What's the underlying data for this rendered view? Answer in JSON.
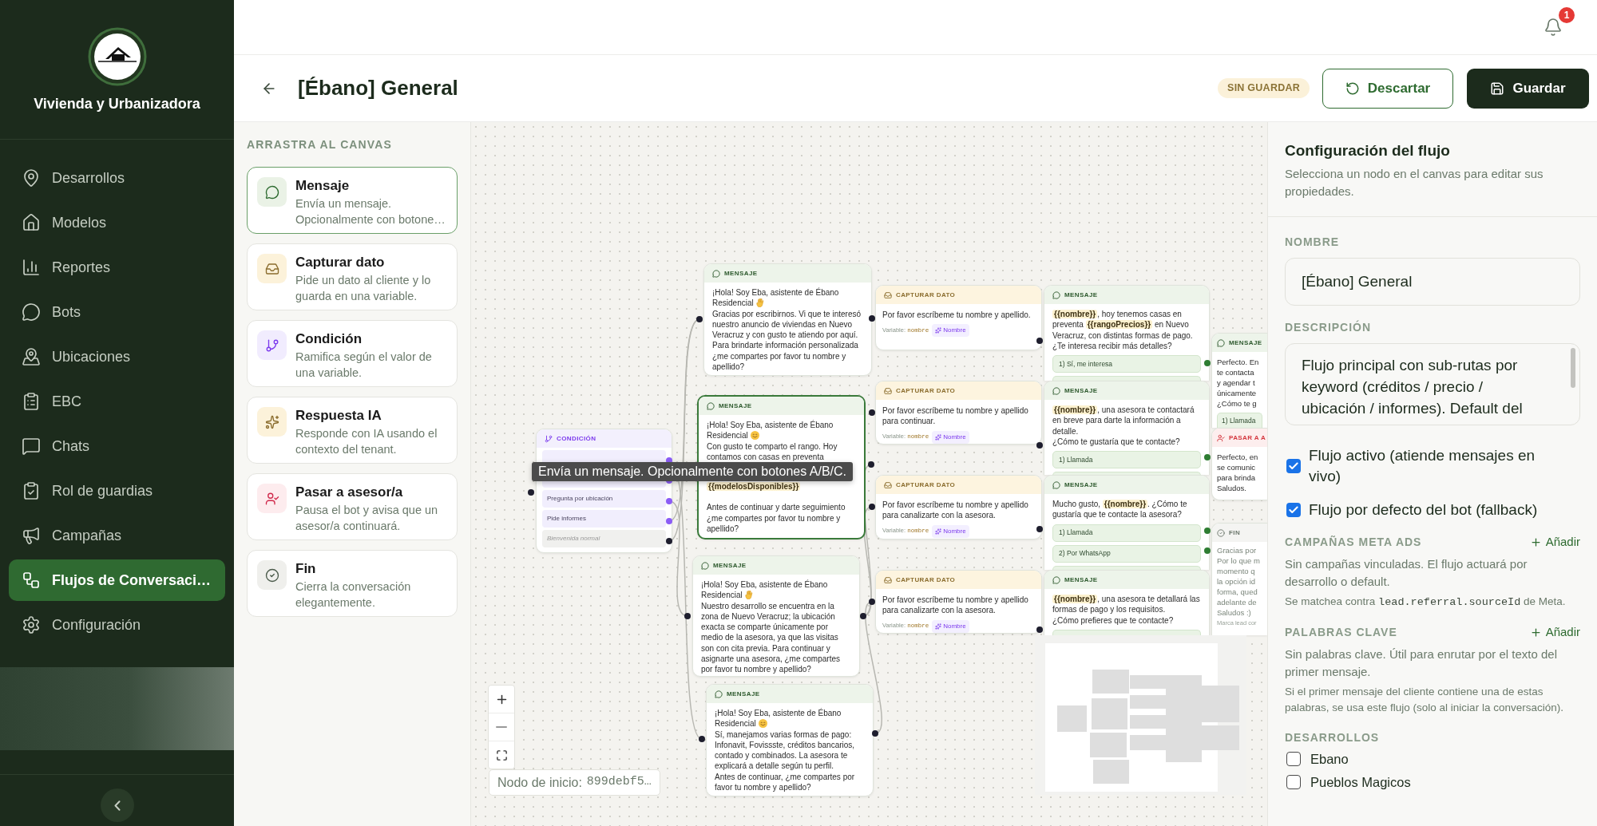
{
  "sidebar": {
    "brand": "Vivienda y Urbanizadora",
    "nav": [
      {
        "label": "Desarrollos",
        "selected": false
      },
      {
        "label": "Modelos",
        "selected": false
      },
      {
        "label": "Reportes",
        "selected": false
      },
      {
        "label": "Bots",
        "selected": false
      },
      {
        "label": "Ubicaciones",
        "selected": false
      },
      {
        "label": "EBC",
        "selected": false
      },
      {
        "label": "Chats",
        "selected": false
      },
      {
        "label": "Rol de guardias",
        "selected": false
      },
      {
        "label": "Campañas",
        "selected": false
      },
      {
        "label": "Flujos de Conversaci…",
        "selected": true
      },
      {
        "label": "Configuración",
        "selected": false
      }
    ]
  },
  "topbar": {
    "notification_count": "1"
  },
  "header": {
    "title": "[Ébano] General",
    "status": "SIN GUARDAR",
    "buttons": [
      {
        "kind": "discard",
        "label": "Descartar"
      },
      {
        "kind": "save",
        "label": "Guardar"
      }
    ]
  },
  "palette": {
    "heading": "ARRASTRA AL CANVAS",
    "items": [
      {
        "kind": "message",
        "title": "Mensaje",
        "description": "Envía un mensaje. Opcionalmente con botone…",
        "selected": true
      },
      {
        "kind": "capture",
        "title": "Capturar dato",
        "description": "Pide un dato al cliente y lo guarda en una variable.",
        "selected": false
      },
      {
        "kind": "condition",
        "title": "Condición",
        "description": "Ramifica según el valor de una variable.",
        "selected": false
      },
      {
        "kind": "ai",
        "title": "Respuesta IA",
        "description": "Responde con IA usando el contexto del tenant.",
        "selected": false
      },
      {
        "kind": "handoff",
        "title": "Pasar a asesor/a",
        "description": "Pausa el bot y avisa que un asesor/a continuará.",
        "selected": false
      },
      {
        "kind": "end",
        "title": "Fin",
        "description": "Cierra la conversación elegantemente.",
        "selected": false
      }
    ]
  },
  "canvas": {
    "nodes": [
      {
        "kind": "condition",
        "header": "CONDICIÓN",
        "rows": [
          {
            "kind": "covered"
          },
          {
            "kind": "covered"
          },
          {
            "kind": "branch",
            "label": "Pregunta por ubicación"
          },
          {
            "kind": "branch",
            "label": "Pide informes"
          },
          {
            "kind": "fallback",
            "label": "Bienvenida normal"
          }
        ]
      },
      {
        "kind": "message",
        "header": "MENSAJE",
        "selected": false,
        "paragraphs": [
          {
            "kind": "text",
            "segments": [
              {
                "kind": "text",
                "text": "¡Hola! Soy Eba, asistente de Ébano"
              }
            ]
          },
          {
            "kind": "text",
            "segments": [
              {
                "kind": "text",
                "text": "Residencial"
              },
              {
                "kind": "wave"
              }
            ]
          },
          {
            "kind": "text",
            "segments": [
              {
                "kind": "text",
                "text": "Gracias por escribirnos. Vi que te interesó nuestro anuncio de viviendas en Nuevo Veracruz y con gusto te atiendo por aquí. Para brindarte información personalizada ¿me compartes por favor tu nombre y apellido?"
              }
            ]
          }
        ]
      },
      {
        "kind": "message",
        "header": "MENSAJE",
        "selected": true,
        "paragraphs": [
          {
            "kind": "text",
            "segments": [
              {
                "kind": "text",
                "text": "¡Hola! Soy Eba, asistente de Ébano"
              }
            ]
          },
          {
            "kind": "text",
            "segments": [
              {
                "kind": "text",
                "text": "Residencial"
              },
              {
                "kind": "smile"
              }
            ]
          },
          {
            "kind": "text",
            "segments": [
              {
                "kind": "text",
                "text": "Con gusto te comparto el rango. Hoy contamos con casas en preventa"
              }
            ]
          },
          {
            "kind": "covered"
          },
          {
            "kind": "text",
            "segments": [
              {
                "kind": "variable",
                "text": "{{modelosDisponibles}}"
              }
            ]
          },
          {
            "kind": "blank"
          },
          {
            "kind": "text",
            "segments": [
              {
                "kind": "text",
                "text": "Antes de continuar y darte seguimiento ¿me compartes por favor tu nombre y apellido?"
              }
            ]
          }
        ]
      },
      {
        "kind": "message",
        "header": "MENSAJE",
        "selected": false,
        "paragraphs": [
          {
            "kind": "text",
            "segments": [
              {
                "kind": "text",
                "text": "¡Hola! Soy Eba, asistente de Ébano"
              }
            ]
          },
          {
            "kind": "text",
            "segments": [
              {
                "kind": "text",
                "text": "Residencial"
              },
              {
                "kind": "wave"
              }
            ]
          },
          {
            "kind": "text",
            "segments": [
              {
                "kind": "text",
                "text": "Nuestro desarrollo se encuentra en la zona de Nuevo Veracruz; la ubicación exacta se comparte únicamente por medio de la asesora, ya que las visitas son con cita previa. Para continuar y asignarte una asesora, ¿me compartes por favor tu nombre y apellido?"
              }
            ]
          }
        ]
      },
      {
        "kind": "message",
        "header": "MENSAJE",
        "selected": false,
        "paragraphs": [
          {
            "kind": "text",
            "segments": [
              {
                "kind": "text",
                "text": "¡Hola! Soy Eba, asistente de Ébano"
              }
            ]
          },
          {
            "kind": "text",
            "segments": [
              {
                "kind": "text",
                "text": "Residencial"
              },
              {
                "kind": "smile"
              }
            ]
          },
          {
            "kind": "text",
            "segments": [
              {
                "kind": "text",
                "text": "Sí, manejamos varias formas de pago: Infonavit, Fovissste, créditos bancarios, contado y combinados. La asesora te explicará a detalle según tu perfil."
              }
            ]
          },
          {
            "kind": "text",
            "segments": [
              {
                "kind": "text",
                "text": "Antes de continuar, ¿me compartes por favor tu nombre y apellido?"
              }
            ]
          }
        ]
      },
      {
        "kind": "capture",
        "header": "CAPTURAR DATO",
        "prompt": "Por favor escríbeme tu nombre y apellido.",
        "variable_label": "Variable:",
        "variable": "nombre",
        "field": "Nombre"
      },
      {
        "kind": "capture",
        "header": "CAPTURAR DATO",
        "prompt": "Por favor escríbeme tu nombre y apellido para continuar.",
        "variable_label": "Variable:",
        "variable": "nombre",
        "field": "Nombre"
      },
      {
        "kind": "capture",
        "header": "CAPTURAR DATO",
        "prompt": "Por favor escríbeme tu nombre y apellido para canalizarte con la asesora.",
        "variable_label": "Variable:",
        "variable": "nombre",
        "field": "Nombre"
      },
      {
        "kind": "capture",
        "header": "CAPTURAR DATO",
        "prompt": "Por favor escríbeme tu nombre y apellido para canalizarte con la asesora.",
        "variable_label": "Variable:",
        "variable": "nombre",
        "field": "Nombre"
      },
      {
        "kind": "message",
        "header": "MENSAJE",
        "selected": false,
        "paragraphs": [
          {
            "kind": "text",
            "segments": [
              {
                "kind": "variable",
                "text": "{{nombre}}"
              },
              {
                "kind": "text",
                "text": ", hoy tenemos casas en preventa "
              },
              {
                "kind": "variable",
                "text": "{{rangoPrecios}}"
              },
              {
                "kind": "text",
                "text": " en Nuevo Veracruz, con distintas formas de pago."
              }
            ]
          },
          {
            "kind": "text",
            "segments": [
              {
                "kind": "text",
                "text": "¿Te interesa recibir más detalles?"
              }
            ]
          }
        ],
        "options": [
          {
            "kind": "button",
            "label": "1) Sí, me interesa"
          },
          {
            "kind": "covered"
          }
        ]
      },
      {
        "kind": "message",
        "header": "MENSAJE",
        "selected": false,
        "paragraphs": [
          {
            "kind": "text",
            "segments": [
              {
                "kind": "variable",
                "text": "{{nombre}}"
              },
              {
                "kind": "text",
                "text": ", una asesora te contactará en breve para darte la información a detalle."
              }
            ]
          },
          {
            "kind": "text",
            "segments": [
              {
                "kind": "text",
                "text": "¿Cómo te gustaría que te contacte?"
              }
            ]
          }
        ],
        "options": [
          {
            "kind": "button",
            "label": "1) Llamada"
          },
          {
            "kind": "covered"
          }
        ]
      },
      {
        "kind": "message",
        "header": "MENSAJE",
        "selected": false,
        "paragraphs": [
          {
            "kind": "text",
            "segments": [
              {
                "kind": "text",
                "text": "Mucho gusto, "
              },
              {
                "kind": "variable",
                "text": "{{nombre}}"
              },
              {
                "kind": "text",
                "text": ". ¿Cómo te gustaría que te contacte la asesora?"
              }
            ]
          }
        ],
        "options": [
          {
            "kind": "button",
            "label": "1) Llamada"
          },
          {
            "kind": "button",
            "label": "2) Por WhatsApp"
          },
          {
            "kind": "covered"
          }
        ]
      },
      {
        "kind": "message",
        "header": "MENSAJE",
        "selected": false,
        "paragraphs": [
          {
            "kind": "text",
            "segments": [
              {
                "kind": "variable",
                "text": "{{nombre}}"
              },
              {
                "kind": "text",
                "text": ", una asesora te detallará las formas de pago y los requisitos."
              }
            ]
          },
          {
            "kind": "text",
            "segments": [
              {
                "kind": "text",
                "text": "¿Cómo prefieres que te contacte?"
              }
            ]
          }
        ],
        "options": [
          {
            "kind": "covered"
          }
        ]
      },
      {
        "kind": "message",
        "header": "MENSAJE",
        "selected": false,
        "paragraphs": [
          {
            "kind": "text",
            "segments": [
              {
                "kind": "text",
                "text": "Perfecto. En\nte contacta\ny agendar t\núnicamente\n¿Cómo te g"
              }
            ]
          }
        ],
        "options": [
          {
            "kind": "button",
            "label": "1) Llamada"
          }
        ]
      },
      {
        "kind": "handoff",
        "header": "PASAR A A",
        "text": "Perfecto, en\nse comunic\npara brinda\nSaludos."
      },
      {
        "kind": "end",
        "header": "FIN",
        "text": "Gracias por\nPor lo que m\nmomento q\nla opción id\nforma, qued\nadelante de\nSaludos :)",
        "note": "Marca lead cor"
      }
    ],
    "start_node": {
      "label": "Nodo de inicio:",
      "value": "899debf5…"
    },
    "tooltip": "Envía un mensaje. Opcionalmente con botones A/B/C."
  },
  "flow_settings": {
    "title": "Configuración del flujo",
    "subtitle": "Selecciona un nodo en el canvas para editar sus propiedades.",
    "name_label": "NOMBRE",
    "name_value": "[Ébano] General",
    "description_label": "DESCRIPCIÓN",
    "description_value": "Flujo principal con sub-rutas por keyword (créditos / precio / ubicación / informes). Default del",
    "options": [
      {
        "label": "Flujo activo (atiende mensajes en vivo)",
        "checked": true
      },
      {
        "label": "Flujo por defecto del bot (fallback)",
        "checked": true
      }
    ],
    "sections": [
      {
        "title": "CAMPAÑAS META ADS",
        "action": "Añadir",
        "empty": "Sin campañas vinculadas. El flujo actuará por desarrollo o default.",
        "hint": {
          "text": "Se matchea contra",
          "code": "lead.referral.sourceId",
          "after": "de Meta."
        }
      },
      {
        "title": "PALABRAS CLAVE",
        "action": "Añadir",
        "empty": "Sin palabras clave. Útil para enrutar por el texto del primer mensaje.",
        "hint": {
          "text": "Si el primer mensaje del cliente contiene una de estas palabras, se usa este flujo (solo al iniciar la conversación)."
        }
      }
    ],
    "developments": {
      "title": "DESARROLLOS",
      "items": [
        {
          "label": "Ebano",
          "checked": false
        },
        {
          "label": "Pueblos Magicos",
          "checked": false
        }
      ]
    }
  }
}
